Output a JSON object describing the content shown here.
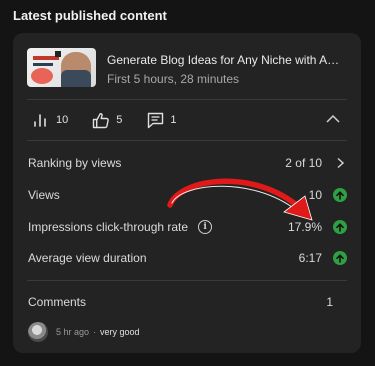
{
  "section": {
    "title": "Latest published content"
  },
  "video": {
    "title": "Generate Blog Ideas for Any Niche with Answer the Public",
    "subtitle": "First 5 hours, 28 minutes"
  },
  "stats": {
    "views": "10",
    "likes": "5",
    "comments": "1"
  },
  "ranking": {
    "label": "Ranking by views",
    "value": "2 of 10"
  },
  "metrics": [
    {
      "label": "Views",
      "value": "10",
      "trend": "up"
    },
    {
      "label": "Impressions click-through rate",
      "value": "17.9%",
      "trend": "up"
    },
    {
      "label": "Average view duration",
      "value": "6:17",
      "trend": "up"
    }
  ],
  "comments_section": {
    "label": "Comments",
    "count": "1",
    "latest": {
      "time": "5 hr ago",
      "text": "very good"
    }
  },
  "colors": {
    "trend_up": "#2ea043",
    "annotation_arrow": "#e01919"
  },
  "icons": {
    "views": "bar-chart-icon",
    "likes": "thumbs-up-icon",
    "comments": "comment-icon",
    "collapse": "chevron-up-icon",
    "ranking": "chevron-right-icon",
    "info": "info-icon",
    "trend": "arrow-up-circle-icon"
  }
}
